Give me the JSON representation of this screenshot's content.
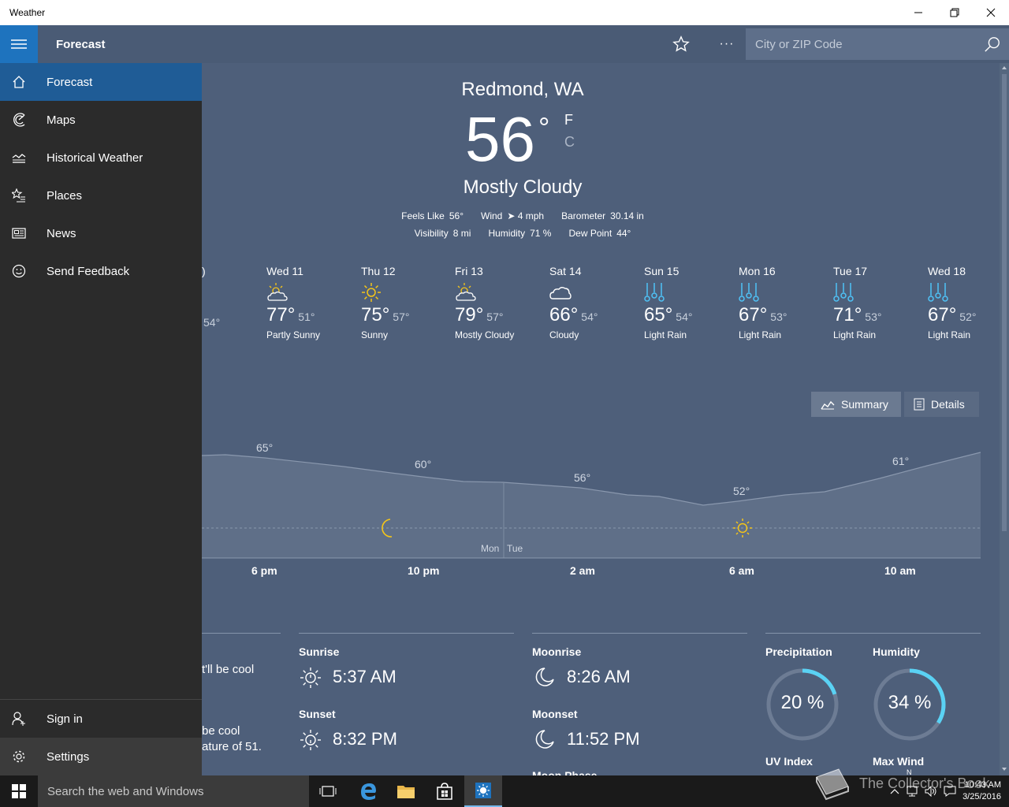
{
  "window": {
    "title": "Weather"
  },
  "appbar": {
    "page_title": "Forecast",
    "more_label": "···",
    "search_placeholder": "City or ZIP Code"
  },
  "current": {
    "location": "Redmond, WA",
    "temp": "56",
    "unit_f": "F",
    "unit_c": "C",
    "condition": "Mostly Cloudy",
    "details_row1": [
      {
        "label": "Feels Like",
        "value": "56°"
      },
      {
        "label": "Wind",
        "value": "➤ 4 mph"
      },
      {
        "label": "Barometer",
        "value": "30.14 in"
      }
    ],
    "details_row2": [
      {
        "label": "Visibility",
        "value": "8 mi"
      },
      {
        "label": "Humidity",
        "value": "71 %"
      },
      {
        "label": "Dew Point",
        "value": "44°"
      }
    ]
  },
  "daily": {
    "partial_name": ")",
    "partial_low": "54°",
    "days": [
      {
        "name": "Wed 11",
        "icon": "partly-sunny-icon",
        "high": "77°",
        "low": "51°",
        "condition": "Partly Sunny"
      },
      {
        "name": "Thu 12",
        "icon": "sunny-icon",
        "high": "75°",
        "low": "57°",
        "condition": "Sunny"
      },
      {
        "name": "Fri 13",
        "icon": "partly-sunny-icon",
        "high": "79°",
        "low": "57°",
        "condition": "Mostly Cloudy"
      },
      {
        "name": "Sat 14",
        "icon": "cloudy-icon",
        "high": "66°",
        "low": "54°",
        "condition": "Cloudy"
      },
      {
        "name": "Sun 15",
        "icon": "light-rain-icon",
        "high": "65°",
        "low": "54°",
        "condition": "Light Rain"
      },
      {
        "name": "Mon 16",
        "icon": "light-rain-icon",
        "high": "67°",
        "low": "53°",
        "condition": "Light Rain"
      },
      {
        "name": "Tue 17",
        "icon": "light-rain-icon",
        "high": "71°",
        "low": "53°",
        "condition": "Light Rain"
      },
      {
        "name": "Wed 18",
        "icon": "light-rain-icon",
        "high": "67°",
        "low": "52°",
        "condition": "Light Rain"
      }
    ]
  },
  "toggle": {
    "summary": "Summary",
    "details": "Details"
  },
  "hourly": {
    "hour_labels": [
      "6 pm",
      "10 pm",
      "2 am",
      "6 am",
      "10 am"
    ],
    "temp_labels": [
      "65°",
      "60°",
      "56°",
      "52°",
      "61°"
    ],
    "day_labels": [
      "Mon",
      "Tue"
    ]
  },
  "sun_moon": {
    "partial_text_1": "t'll be cool",
    "partial_text_2": "be cool",
    "partial_text_3": "ature of 51.",
    "sunrise_label": "Sunrise",
    "sunrise": "5:37 AM",
    "sunset_label": "Sunset",
    "sunset": "8:32 PM",
    "moonrise_label": "Moonrise",
    "moonrise": "8:26 AM",
    "moonset_label": "Moonset",
    "moonset": "11:52 PM",
    "moonphase_label": "Moon Phase"
  },
  "gauges": {
    "precip_label": "Precipitation",
    "precip_value": "20 %",
    "precip_fraction": 0.2,
    "humidity_label": "Humidity",
    "humidity_value": "34 %",
    "humidity_fraction": 0.34,
    "uv_label": "UV Index",
    "wind_label": "Max Wind",
    "wind_dir": "N"
  },
  "sidebar": {
    "items": [
      {
        "label": "Forecast",
        "icon": "home-icon"
      },
      {
        "label": "Maps",
        "icon": "maps-icon"
      },
      {
        "label": "Historical Weather",
        "icon": "historical-icon"
      },
      {
        "label": "Places",
        "icon": "places-icon"
      },
      {
        "label": "News",
        "icon": "news-icon"
      },
      {
        "label": "Send Feedback",
        "icon": "feedback-icon"
      }
    ],
    "sign_in": "Sign in",
    "settings": "Settings"
  },
  "taskbar": {
    "search_placeholder": "Search the web and Windows",
    "time": "10:43 AM",
    "date": "3/25/2016"
  },
  "watermark": {
    "text": "The Collector's Book"
  },
  "colors": {
    "accent": "#1e73be",
    "sun": "#f5c518",
    "rain": "#4fc3f7",
    "gauge": "#5ad2f4",
    "panel": "#4e5f7a",
    "sidebar": "#2b2b2b"
  }
}
